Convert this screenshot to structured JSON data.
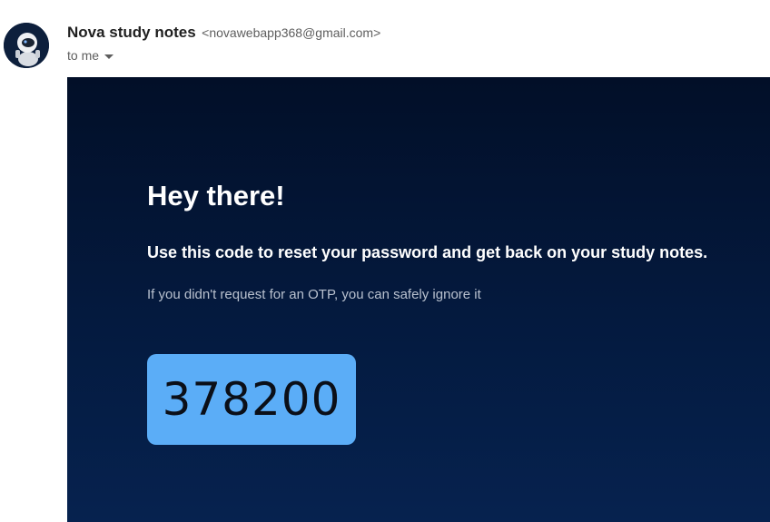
{
  "sender": {
    "name": "Nova study notes",
    "email": "<novawebapp368@gmail.com>"
  },
  "recipient": {
    "label": "to me"
  },
  "body": {
    "greeting": "Hey there!",
    "instruction": "Use this code to reset your password and get back on your study notes.",
    "note": "If you didn't request for an OTP, you can safely ignore it",
    "otp": "378200"
  },
  "colors": {
    "body_background_top": "#020f28",
    "body_background_bottom": "#06224f",
    "otp_box": "#5badf7"
  },
  "icons": {
    "avatar": "astronaut-avatar-icon",
    "recipient_toggle": "caret-down-icon"
  }
}
